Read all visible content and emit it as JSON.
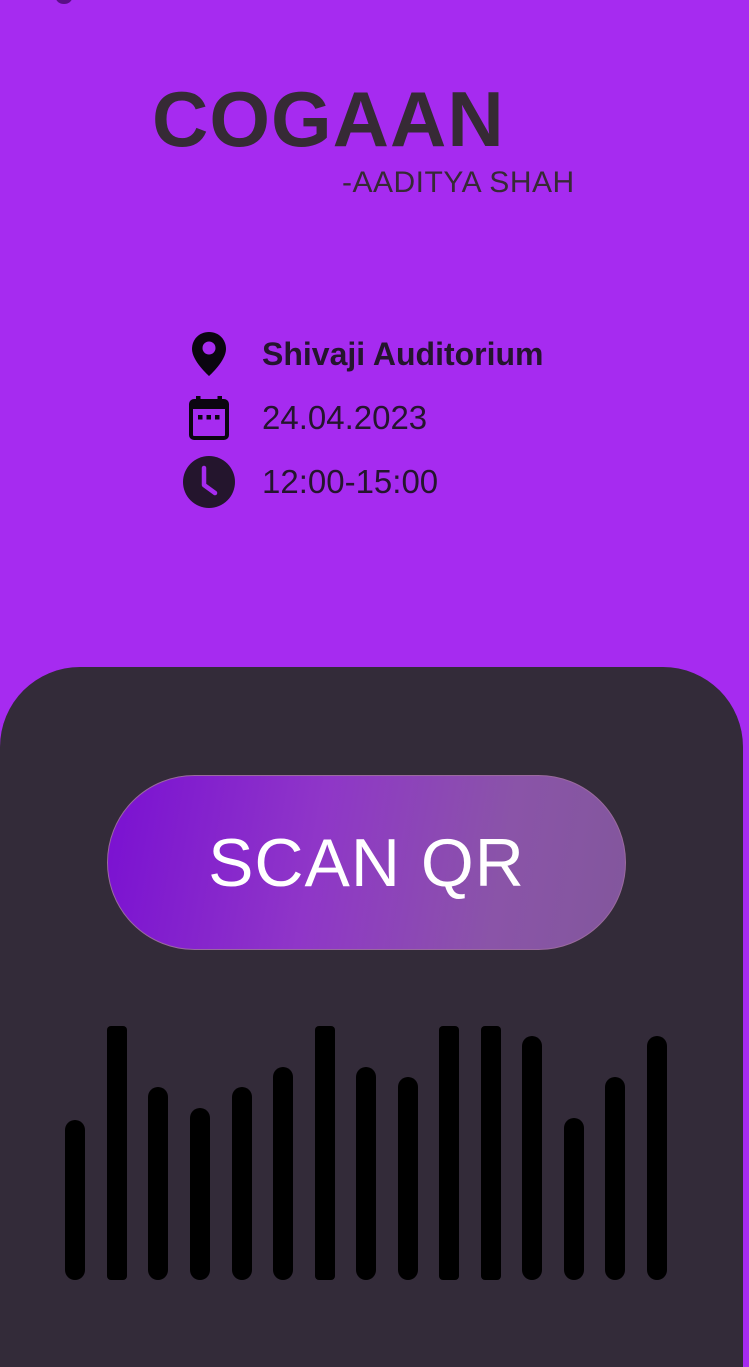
{
  "event": {
    "title": "COGAAN",
    "subtitle": "-AADITYA SHAH"
  },
  "details": {
    "venue": {
      "icon": "location-pin-icon",
      "text": "Shivaji Auditorium"
    },
    "date": {
      "icon": "calendar-icon",
      "text": "24.04.2023"
    },
    "time": {
      "icon": "clock-icon",
      "text": "12:00-15:00"
    }
  },
  "actions": {
    "scan_label": "SCAN QR"
  },
  "colors": {
    "background": "#a62bf0",
    "panel": "#332b39",
    "title_text": "#362a35",
    "bars": "#000000"
  },
  "decor": {
    "icon": "sound-wave-bars-icon"
  }
}
